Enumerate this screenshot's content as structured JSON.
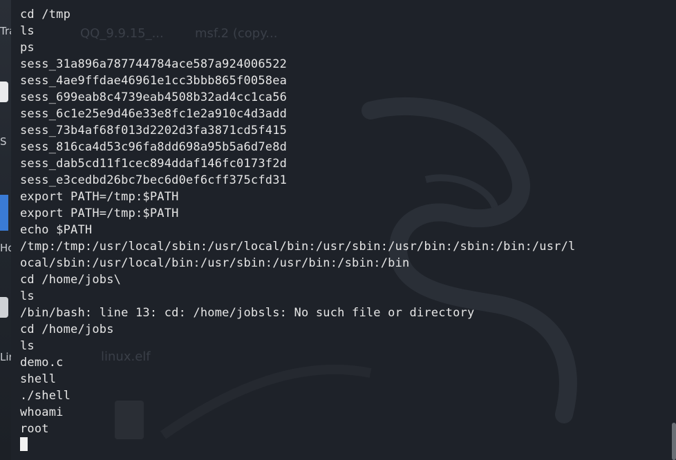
{
  "desktop": {
    "fragments": [
      "Tra",
      "S",
      "Ho",
      "Lin"
    ],
    "ghost_labels": [
      "QQ_9.9.15_...",
      "msf.2 (copy...",
      "linux.elf"
    ]
  },
  "terminal": {
    "lines": [
      "cd /tmp",
      "ls",
      "ps",
      "sess_31a896a787744784ace587a924006522",
      "sess_4ae9ffdae46961e1cc3bbb865f0058ea",
      "sess_699eab8c4739eab4508b32ad4cc1ca56",
      "sess_6c1e25e9d46e33e8fc1e2a910c4d3add",
      "sess_73b4af68f013d2202d3fa3871cd5f415",
      "sess_816ca4d53c96fa8dd698a95b5a6d7e8d",
      "sess_dab5cd11f1cec894ddaf146fc0173f2d",
      "sess_e3cedbd26bc7bec6d0ef6cff375cfd31",
      "export PATH=/tmp:$PATH",
      "export PATH=/tmp:$PATH",
      "echo $PATH",
      "/tmp:/tmp:/usr/local/sbin:/usr/local/bin:/usr/sbin:/usr/bin:/sbin:/bin:/usr/l",
      "ocal/sbin:/usr/local/bin:/usr/sbin:/usr/bin:/sbin:/bin",
      "cd /home/jobs\\",
      "ls",
      "/bin/bash: line 13: cd: /home/jobsls: No such file or directory",
      "cd /home/jobs",
      "ls",
      "demo.c",
      "shell",
      "./shell",
      "whoami",
      "root"
    ]
  },
  "colors": {
    "background": "#1e2229",
    "text": "#e6e6e6",
    "cursor": "#f2f2f2"
  }
}
